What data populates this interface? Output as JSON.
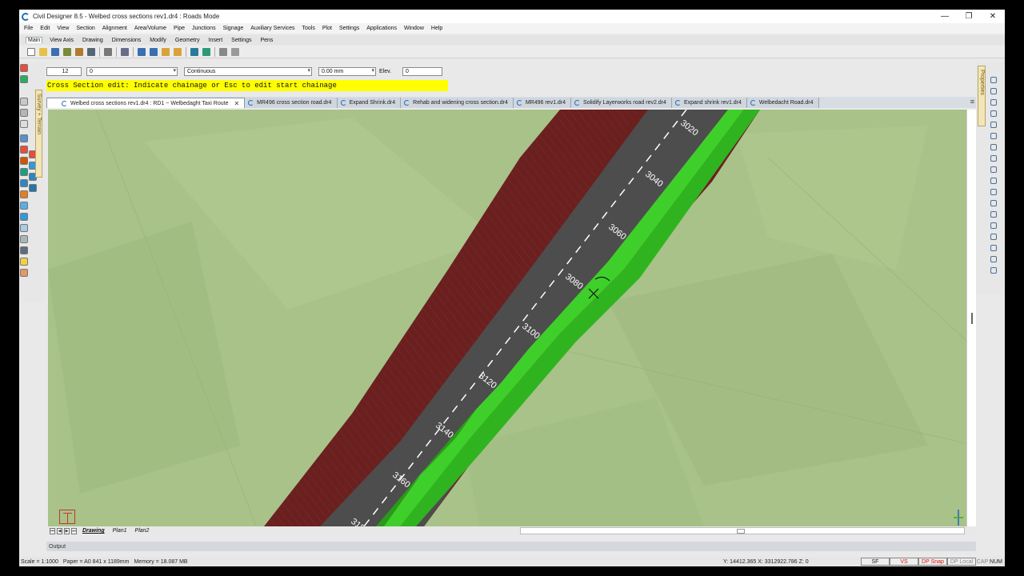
{
  "window": {
    "title": "Civil Designer 8.5 - Welbed cross sections rev1.dr4 : Roads Mode",
    "minimize": "—",
    "maximize": "❐",
    "close": "✕"
  },
  "menu": [
    "File",
    "Edit",
    "View",
    "Section",
    "Alignment",
    "Area/Volume",
    "Pipe",
    "Junctions",
    "Signage",
    "Auxiliary Services",
    "Tools",
    "Plot",
    "Settings",
    "Applications",
    "Window",
    "Help"
  ],
  "ribbon_tabs": [
    "Main",
    "View Axis",
    "Drawing",
    "Dimensions",
    "Modify",
    "Geometry",
    "Insert",
    "Settings",
    "Pens"
  ],
  "command_bar": {
    "field1": "12",
    "field2": "0",
    "linetype": "Continuous",
    "width": "0.00 mm",
    "elev_label": "Elev.",
    "elev_value": "0"
  },
  "prompt": "Cross Section edit: Indicate chainage or Esc to edit start chainage",
  "doc_tabs": [
    "Welbed cross sections rev1.dr4 : RD1 ~ Welbedaght Taxi Route",
    "MR496 cross section road.dr4",
    "Expand Shrink.dr4",
    "Rehab and widening cross section.dr4",
    "MR496 rev1.dr4",
    "Solidify Layerworks road rev2.dr4",
    "Expand shrink rev1.dr4",
    "Welbedacht Road.dr4"
  ],
  "side_tabs": {
    "left": "Survey + Terrain",
    "right": "Properties"
  },
  "chainage_labels": [
    "3020",
    "3040",
    "3060",
    "3080",
    "3100",
    "3120",
    "3140",
    "3160",
    "3180"
  ],
  "sheet_tabs": [
    "Drawing",
    "Plan1",
    "Plan2"
  ],
  "output_label": "Output",
  "status": {
    "scale": "Scale = 1:1000",
    "paper": "Paper = A0 841 x 1189mm",
    "memory": "Memory = 18.087 MB",
    "coords": "Y: 14412.365 X: 3312922.786 Z: 0",
    "sf": "SF",
    "vs": "VS",
    "dp_snap": "DP Snap",
    "dp_local": "DP Local",
    "cap": "CAP",
    "num": "NUM"
  },
  "colors": {
    "terrain": "#a8c289",
    "road_surface": "#4d4d4d",
    "shoulder": "#3fcf2a",
    "fill_batter": "#6b2020",
    "prompt_bg": "#ffff00"
  }
}
